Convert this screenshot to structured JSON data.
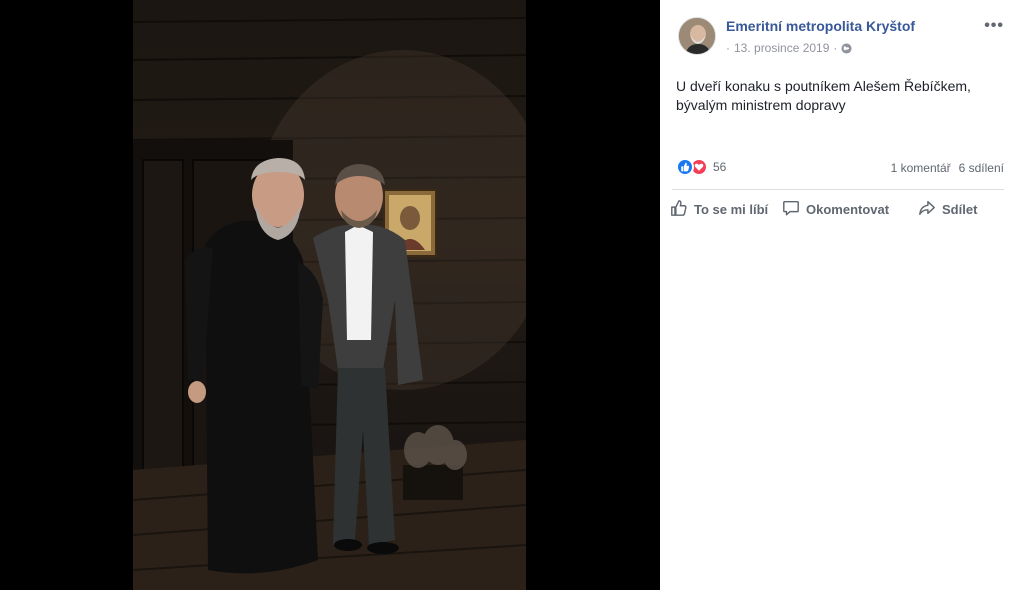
{
  "post": {
    "author": "Emeritní metropolita Kryštof",
    "date": "13. prosince 2019",
    "date_prefix": "·",
    "more_label": "•••",
    "caption_line1": "U dveří konaku s poutníkem Alešem Řebíčkem,",
    "caption_line2": "bývalým ministrem dopravy",
    "reaction_count": "56",
    "comments": "1 komentář",
    "shares": "6 sdílení",
    "reaction_icons": [
      "like-icon",
      "love-icon"
    ]
  },
  "actions": {
    "like": "To se mi líbí",
    "comment": "Okomentovat",
    "share": "Sdílet"
  },
  "colors": {
    "author_link": "#385898",
    "like_blue": "#1877f2",
    "love_red": "#f33e58",
    "viewer_bg": "#000000"
  }
}
